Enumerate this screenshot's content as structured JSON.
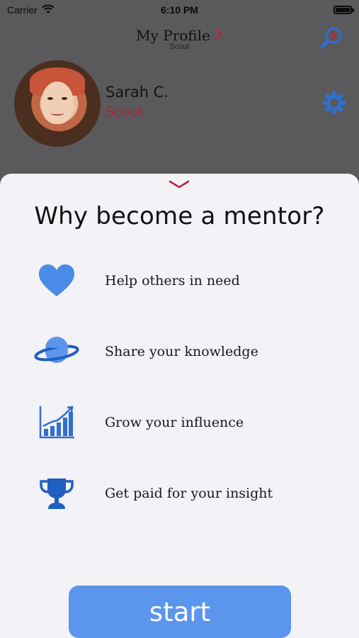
{
  "status_bar": {
    "carrier": "Carrier",
    "time": "6:10 PM"
  },
  "header": {
    "title": "My Profile",
    "subtitle": "Scout"
  },
  "profile": {
    "name": "Sarah C.",
    "role": "Scout"
  },
  "sheet": {
    "title": "Why become a mentor?",
    "reasons": [
      {
        "icon": "heart-icon",
        "label": "Help others in need"
      },
      {
        "icon": "planet-icon",
        "label": "Share your knowledge"
      },
      {
        "icon": "growth-chart-icon",
        "label": "Grow your influence"
      },
      {
        "icon": "trophy-icon",
        "label": "Get paid for your insight"
      }
    ],
    "start_label": "start"
  },
  "colors": {
    "accent_blue": "#5c95ec",
    "icon_blue": "#4a8be8",
    "accent_red": "#c0213a"
  }
}
